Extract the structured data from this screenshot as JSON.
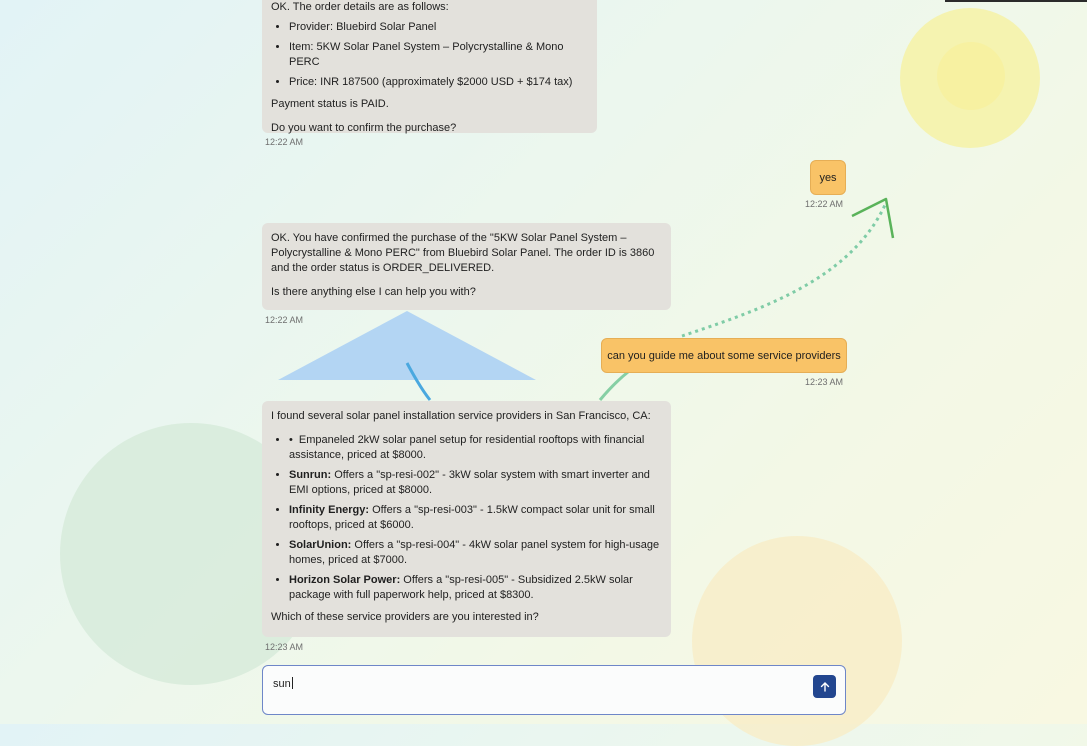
{
  "messages": {
    "bot1": {
      "intro": "OK. The order details are as follows:",
      "items": [
        "Provider: Bluebird Solar Panel",
        "Item: 5KW Solar Panel System – Polycrystalline & Mono PERC",
        "Price: INR 187500 (approximately $2000 USD + $174 tax)"
      ],
      "status": "Payment status is PAID.",
      "question": "Do you want to confirm the purchase?",
      "time": "12:22 AM"
    },
    "user1": {
      "text": "yes",
      "time": "12:22 AM"
    },
    "bot2": {
      "text": "OK. You have confirmed the purchase of the \"5KW Solar Panel System – Polycrystalline & Mono PERC\" from Bluebird Solar Panel. The order ID is 3860 and the order status is ORDER_DELIVERED.",
      "question": "Is there anything else I can help you with?",
      "time": "12:22 AM"
    },
    "user2": {
      "text": "can you guide me about some service providers",
      "time": "12:23 AM"
    },
    "bot3": {
      "intro": "I found several solar panel installation service providers in San Francisco, CA:",
      "providers": [
        {
          "name": "",
          "desc": "Empaneled 2kW solar panel setup for residential rooftops with financial assistance, priced at $8000."
        },
        {
          "name": "Sunrun:",
          "desc": " Offers a \"sp-resi-002\" - 3kW solar system with smart inverter and EMI options, priced at $8000."
        },
        {
          "name": "Infinity Energy:",
          "desc": " Offers a \"sp-resi-003\" - 1.5kW compact solar unit for small rooftops, priced at $6000."
        },
        {
          "name": "SolarUnion:",
          "desc": " Offers a \"sp-resi-004\" - 4kW solar panel system for high-usage homes, priced at $7000."
        },
        {
          "name": "Horizon Solar Power:",
          "desc": " Offers a \"sp-resi-005\" - Subsidized 2.5kW solar package with full paperwork help, priced at $8300."
        }
      ],
      "question": "Which of these service providers are you interested in?",
      "time": "12:23 AM"
    }
  },
  "composer": {
    "value": "sun",
    "send_icon": "arrow-up-icon"
  },
  "colors": {
    "user_bubble": "#f9c367",
    "bot_bubble": "#e3e1dc",
    "send_button": "#22468f",
    "arrow": "#5ab35a"
  }
}
